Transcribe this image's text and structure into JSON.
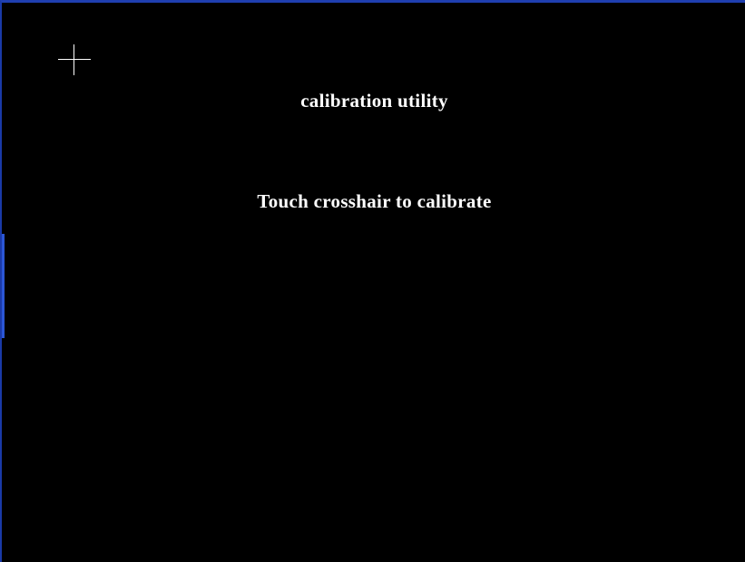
{
  "window": {
    "title": "calibration utility",
    "instruction": "Touch crosshair to calibrate"
  },
  "icons": {
    "target": "crosshair-icon"
  },
  "colors": {
    "background": "#000000",
    "text": "#ffffff",
    "frame_border": "#1f3fb0"
  }
}
